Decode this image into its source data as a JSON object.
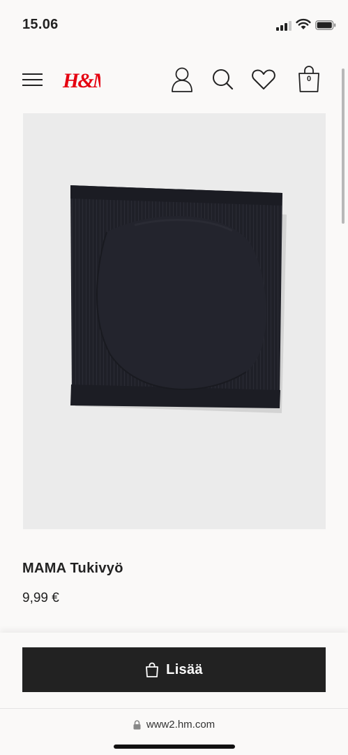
{
  "status_bar": {
    "time": "15.06"
  },
  "header": {
    "logo_text": "H&M",
    "bag_count": "0",
    "icons": [
      "menu-icon",
      "user-icon",
      "search-icon",
      "heart-icon",
      "shopping-bag-icon"
    ]
  },
  "product": {
    "title": "MAMA Tukivyö",
    "price": "9,99 €"
  },
  "actions": {
    "add_label": "Lisää"
  },
  "browser": {
    "url": "www2.hm.com"
  },
  "colors": {
    "brand": "#e50010",
    "button": "#222222",
    "image_bg": "#ebebeb",
    "product": "#1f2028"
  }
}
